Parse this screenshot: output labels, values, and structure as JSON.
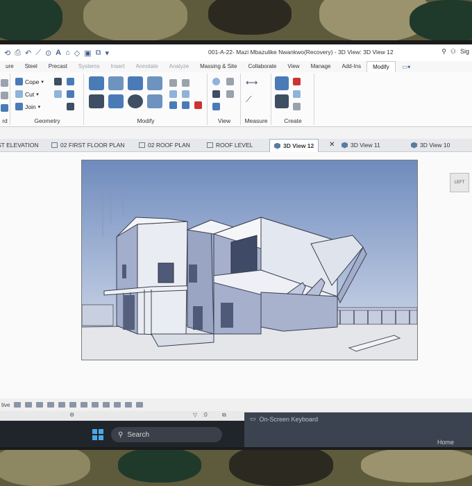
{
  "window": {
    "title": "001-A-22- Mazi Mbazulike Nwankwo(Recovery) - 3D View: 3D View 12",
    "sign_in": "Sig"
  },
  "ribbon_tabs": [
    {
      "label": "ure",
      "state": "normal"
    },
    {
      "label": "Steel",
      "state": "normal"
    },
    {
      "label": "Precast",
      "state": "normal"
    },
    {
      "label": "Systems",
      "state": "dim"
    },
    {
      "label": "Insert",
      "state": "dim"
    },
    {
      "label": "Annotate",
      "state": "dim"
    },
    {
      "label": "Analyze",
      "state": "dim"
    },
    {
      "label": "Massing & Site",
      "state": "normal"
    },
    {
      "label": "Collaborate",
      "state": "normal"
    },
    {
      "label": "View",
      "state": "normal"
    },
    {
      "label": "Manage",
      "state": "normal"
    },
    {
      "label": "Add-Ins",
      "state": "normal"
    },
    {
      "label": "Modify",
      "state": "active"
    }
  ],
  "ribbon": {
    "clipboard_label": "rd",
    "geometry": {
      "cope": "Cope",
      "cut": "Cut",
      "join": "Join",
      "label": "Geometry"
    },
    "modify_label": "Modify",
    "view_label": "View",
    "measure_label": "Measure",
    "create_label": "Create"
  },
  "view_tabs": [
    {
      "label": "ST ELEVATION",
      "active": false
    },
    {
      "label": "02 FIRST FLOOR PLAN",
      "active": false
    },
    {
      "label": "02 ROOF PLAN",
      "active": false
    },
    {
      "label": "ROOF LEVEL",
      "active": false
    },
    {
      "label": "3D View 12",
      "active": true
    },
    {
      "label": "3D View 11",
      "active": false
    },
    {
      "label": "3D View 10",
      "active": false
    }
  ],
  "viewcube": {
    "face": "LEFT"
  },
  "statusbar": {
    "left_text": "tive",
    "zero": ":0"
  },
  "taskbar": {
    "search_label": "Search",
    "osk_title": "On-Screen Keyboard",
    "osk_home": "Home"
  },
  "colors": {
    "accent": "#4a7bb7",
    "sky": "#8fa7cf",
    "wall": "#e9ecf2",
    "shadow_wall": "#9aa5c3"
  }
}
